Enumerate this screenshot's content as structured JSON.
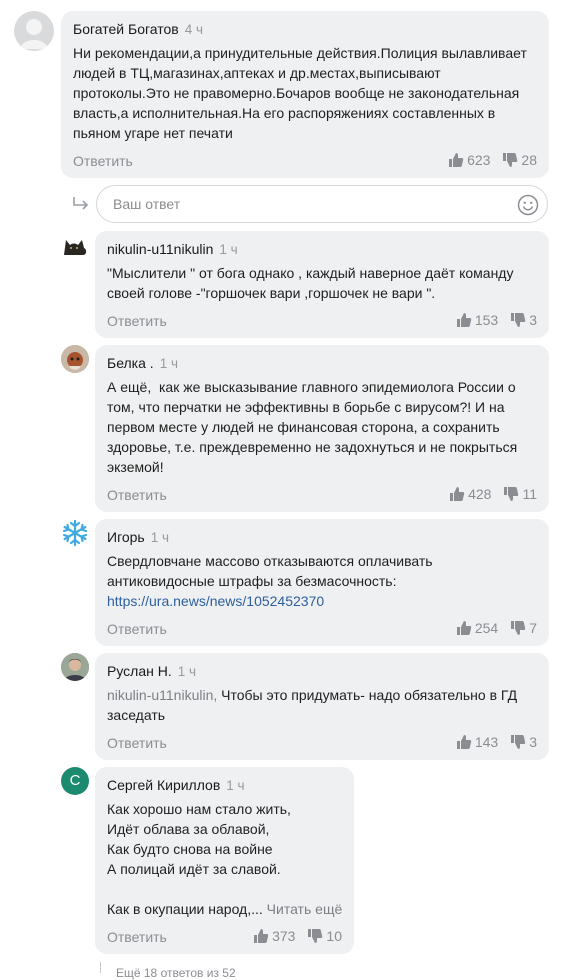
{
  "comments": [
    {
      "author": "Богатей Богатов",
      "time": "4 ч",
      "lines": [
        "Ни рекомендации,а принудительные действия.Полиция вылавливает",
        "людей в ТЦ,магазинах,аптеках и др.местах,выписывают",
        "протоколы.Это не правомерно.Бочаров вообще не законодательная",
        "власть,а исполнительная.На его распоряжениях составленных в",
        "пьяном угаре нет печати"
      ],
      "reply": "Ответить",
      "likes": "623",
      "dislikes": "28"
    },
    {
      "author": "nikulin-u11nikulin",
      "time": "1 ч",
      "lines": [
        "\"Мыслители \" от бога однако , каждый наверное даёт команду",
        "своей голове -\"горшочек вари ,горшочек не вари \"."
      ],
      "reply": "Ответить",
      "likes": "153",
      "dislikes": "3"
    },
    {
      "author": "Белка .",
      "time": "1 ч",
      "lines": [
        "А ещё,  как же высказывание главного эпидемиолога России о",
        "том, что перчатки не эффективны в борьбе с вирусом?! И на",
        "первом месте у людей не финансовая сторона, а сохранить",
        "здоровье, т.е. преждевременно не задохнуться и не покрыться",
        "экземой!"
      ],
      "reply": "Ответить",
      "likes": "428",
      "dislikes": "11"
    },
    {
      "author": "Игорь",
      "time": "1 ч",
      "lines": [
        "Свердловчане массово отказываются оплачивать",
        "антиковидосные штрафы за безмасочность:"
      ],
      "link": "https://ura.news/news/1052452370",
      "reply": "Ответить",
      "likes": "254",
      "dislikes": "7"
    },
    {
      "author": "Руслан Н.",
      "time": "1 ч",
      "mention": "nikulin-u11nikulin,",
      "lines": [
        " Чтобы это придумать- надо обязательно в ГД",
        "заседать"
      ],
      "reply": "Ответить",
      "likes": "143",
      "dislikes": "3"
    },
    {
      "author": "Сергей Кириллов",
      "time": "1 ч",
      "avatar_letter": "С",
      "lines": [
        "Как хорошо нам стало жить,",
        "Идёт облава за облавой,",
        "Как будто снова на войне",
        "А полицай идёт за славой.",
        "",
        "Как в окупации народ,..."
      ],
      "read_more": "Читать ещё",
      "reply": "Ответить",
      "likes": "373",
      "dislikes": "10"
    }
  ],
  "reply_input": {
    "placeholder": "Ваш ответ"
  },
  "footer": "Ещё 18 ответов из 52",
  "colors": {
    "bubble": "#eff0f2",
    "link": "#2c5f9e",
    "muted": "#8b8d93",
    "avatar_green": "#1c8a6e",
    "snow": "#3fa9e0"
  }
}
